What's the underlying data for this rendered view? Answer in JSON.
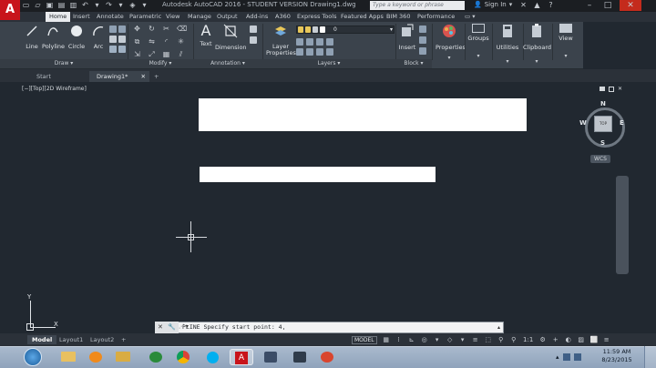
{
  "window": {
    "title": "Autodesk AutoCAD 2016 - STUDENT VERSION    Drawing1.dwg",
    "search_placeholder": "Type a keyword or phrase",
    "signin": "Sign In",
    "logo": "A"
  },
  "ribbon_tabs": [
    "Home",
    "Insert",
    "Annotate",
    "Parametric",
    "View",
    "Manage",
    "Output",
    "Add-ins",
    "A360",
    "Express Tools",
    "Featured Apps",
    "BIM 360",
    "Performance"
  ],
  "draw_panel": {
    "tools": [
      "Line",
      "Polyline",
      "Circle",
      "Arc"
    ],
    "footer": "Draw ▾"
  },
  "modify_panel": {
    "footer": "Modify ▾"
  },
  "annotation_panel": {
    "tools": [
      "Text",
      "Dimension"
    ],
    "footer": "Annotation ▾"
  },
  "layers_panel": {
    "layer_props": "Layer Properties",
    "current_layer": "0",
    "footer": "Layers ▾"
  },
  "block_panel": {
    "insert": "Insert",
    "footer": "Block ▾"
  },
  "other_buttons": [
    "Properties",
    "Groups",
    "Utilities",
    "Clipboard",
    "View"
  ],
  "file_tabs": [
    {
      "label": "Start",
      "active": false
    },
    {
      "label": "Drawing1*",
      "active": true
    }
  ],
  "add_tab": "+",
  "viewport_label": "[−][Top][2D Wireframe]",
  "viewcube": {
    "north": "N",
    "south": "S",
    "east": "E",
    "west": "W",
    "face": "TOP",
    "wcs": "WCS"
  },
  "ucs": {
    "x": "X",
    "y": "Y"
  },
  "command_line": "PLINE Specify start point: 4,",
  "layout_tabs": [
    {
      "label": "Model",
      "active": true
    },
    {
      "label": "Layout1",
      "active": false
    },
    {
      "label": "Layout2",
      "active": false
    }
  ],
  "status": {
    "model": "MODEL",
    "scale": "1:1"
  },
  "clock": {
    "time": "11:59 AM",
    "date": "8/23/2015"
  },
  "colors": {
    "autocad_red": "#c8141b",
    "viewport_bg": "#212830",
    "ribbon_bg": "#3b434c"
  }
}
